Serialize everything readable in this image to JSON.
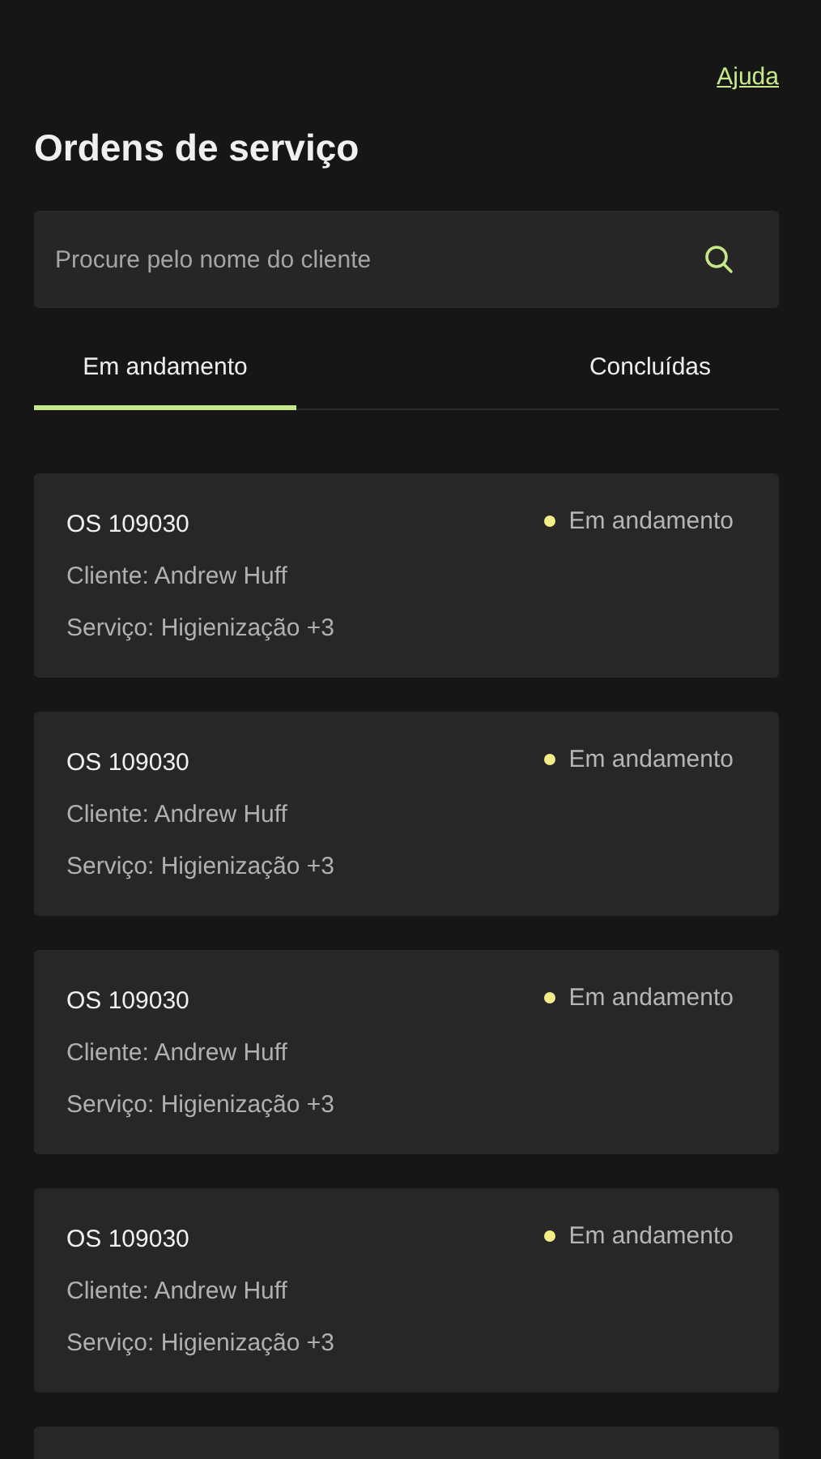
{
  "help_link": "Ajuda",
  "title": "Ordens de serviço",
  "search": {
    "placeholder": "Procure pelo nome do cliente"
  },
  "tabs": [
    {
      "label": "Em andamento",
      "selected": true
    },
    {
      "label": "Concluídas",
      "selected": false
    }
  ],
  "orders": [
    {
      "number": "OS 109030",
      "status": "Em andamento",
      "color": "#f3ee8a",
      "client": "Cliente: Andrew Huff",
      "service": "Serviço: Higienização +3"
    },
    {
      "number": "OS 109030",
      "status": "Em andamento",
      "color": "#f3ee8a",
      "client": "Cliente: Andrew Huff",
      "service": "Serviço: Higienização +3"
    },
    {
      "number": "OS 109030",
      "status": "Em andamento",
      "color": "#f3ee8a",
      "client": "Cliente: Andrew Huff",
      "service": "Serviço: Higienização +3"
    },
    {
      "number": "OS 109030",
      "status": "Em andamento",
      "color": "#f3ee8a",
      "client": "Cliente: Andrew Huff",
      "service": "Serviço: Higienização +3"
    }
  ]
}
